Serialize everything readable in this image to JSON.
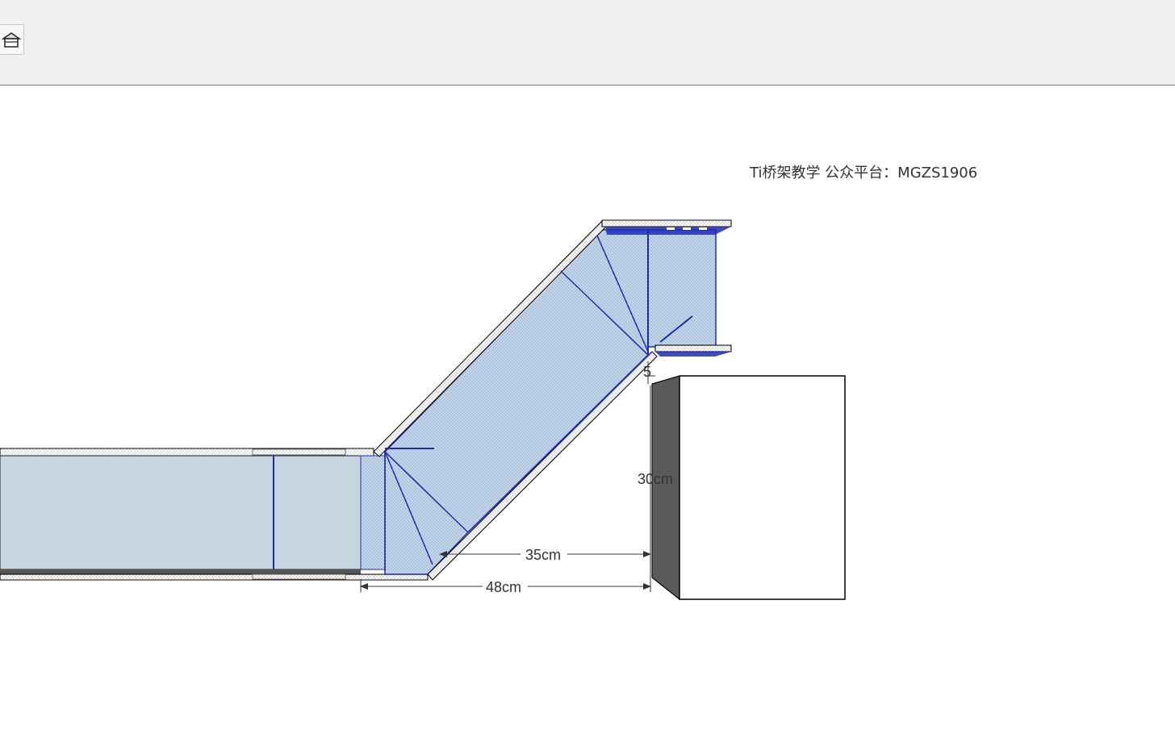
{
  "toolbar": {
    "home_button_icon": "home-icon"
  },
  "watermark": {
    "text": "Ti桥架教学 公众平台：MGZS1906"
  },
  "dimensions": {
    "horizontal_inner": "35cm",
    "horizontal_outer": "48cm",
    "vertical_height": "30cm",
    "small_gap": "5"
  },
  "colors": {
    "tray_fill": "#c5d9ea",
    "tray_edge": "#1c2bb5",
    "block_side": "#555555",
    "toolbar_bg": "#f0f0f0"
  }
}
